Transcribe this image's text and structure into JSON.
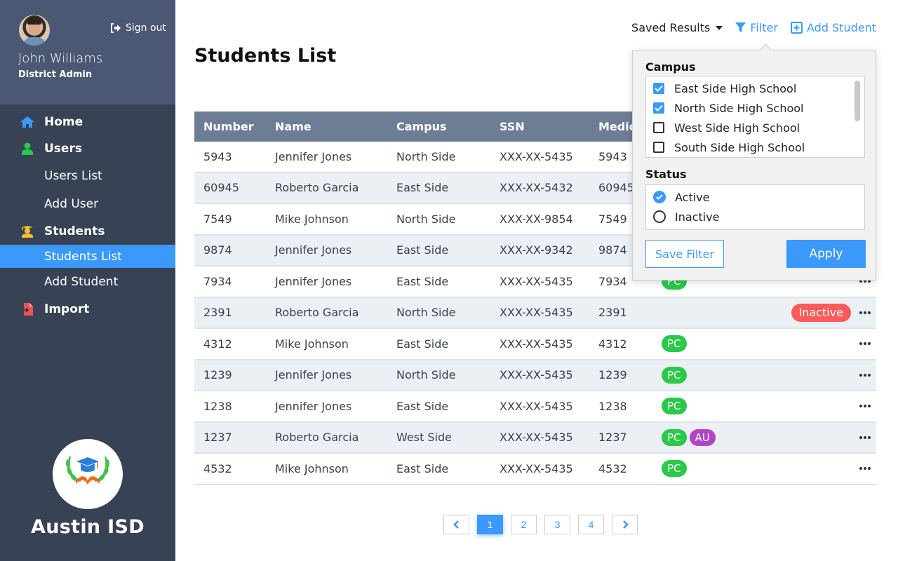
{
  "sidebar": {
    "user": {
      "name": "John Williams",
      "role": "District Admin",
      "avatar": "user-photo"
    },
    "signout_label": "Sign out",
    "nav": {
      "home": "Home",
      "users": "Users",
      "users_list": "Users List",
      "add_user": "Add User",
      "students": "Students",
      "students_list": "Students List",
      "add_student": "Add Student",
      "import": "Import"
    },
    "brand_name": "Austin ISD"
  },
  "header": {
    "title": "Students List",
    "saved_results": "Saved Results",
    "filter": "Filter",
    "add_student": "Add Student"
  },
  "table": {
    "columns": [
      "Number",
      "Name",
      "Campus",
      "SSN",
      "Medic"
    ],
    "rows": [
      {
        "number": "5943",
        "name": "Jennifer Jones",
        "campus": "North Side",
        "ssn": "XXX-XX-5435",
        "medic": "5943",
        "tags": [],
        "status": ""
      },
      {
        "number": "60945",
        "name": "Roberto Garcia",
        "campus": "East Side",
        "ssn": "XXX-XX-5432",
        "medic": "60945",
        "tags": [],
        "status": ""
      },
      {
        "number": "7549",
        "name": "Mike Johnson",
        "campus": "North Side",
        "ssn": "XXX-XX-9854",
        "medic": "7549",
        "tags": [],
        "status": ""
      },
      {
        "number": "9874",
        "name": "Jennifer Jones",
        "campus": "East Side",
        "ssn": "XXX-XX-9342",
        "medic": "9874",
        "tags": [],
        "status": ""
      },
      {
        "number": "7934",
        "name": "Jennifer Jones",
        "campus": "East Side",
        "ssn": "XXX-XX-5435",
        "medic": "7934",
        "tags": [
          "PC"
        ],
        "status": ""
      },
      {
        "number": "2391",
        "name": "Roberto Garcia",
        "campus": "North Side",
        "ssn": "XXX-XX-5435",
        "medic": "2391",
        "tags": [],
        "status": "Inactive"
      },
      {
        "number": "4312",
        "name": "Mike Johnson",
        "campus": "East Side",
        "ssn": "XXX-XX-5435",
        "medic": "4312",
        "tags": [
          "PC"
        ],
        "status": ""
      },
      {
        "number": "1239",
        "name": "Jennifer Jones",
        "campus": "North Side",
        "ssn": "XXX-XX-5435",
        "medic": "1239",
        "tags": [
          "PC"
        ],
        "status": ""
      },
      {
        "number": "1238",
        "name": "Jennifer Jones",
        "campus": "East Side",
        "ssn": "XXX-XX-5435",
        "medic": "1238",
        "tags": [
          "PC"
        ],
        "status": ""
      },
      {
        "number": "1237",
        "name": "Roberto Garcia",
        "campus": "West Side",
        "ssn": "XXX-XX-5435",
        "medic": "1237",
        "tags": [
          "PC",
          "AU"
        ],
        "status": ""
      },
      {
        "number": "4532",
        "name": "Mike Johnson",
        "campus": "East Side",
        "ssn": "XXX-XX-5435",
        "medic": "4532",
        "tags": [
          "PC"
        ],
        "status": ""
      }
    ]
  },
  "pagination": {
    "pages": [
      "1",
      "2",
      "3",
      "4"
    ],
    "current": "1"
  },
  "filter_popup": {
    "campus_label": "Campus",
    "campus_options": [
      {
        "label": "East Side High School",
        "checked": true
      },
      {
        "label": "North Side High School",
        "checked": true
      },
      {
        "label": "West Side High School",
        "checked": false
      },
      {
        "label": "South Side High School",
        "checked": false
      }
    ],
    "status_label": "Status",
    "status_options": [
      {
        "label": "Active",
        "selected": true
      },
      {
        "label": "Inactive",
        "selected": false
      }
    ],
    "save_filter": "Save Filter",
    "apply": "Apply"
  },
  "colors": {
    "accent": "#3a99fa",
    "sidebar_bg": "#374254",
    "profile_bg": "#4b5874",
    "table_header": "#6e7d96",
    "tag_pc": "#2bc84a",
    "tag_au": "#b444c6",
    "status_inactive": "#fb5b5b"
  }
}
